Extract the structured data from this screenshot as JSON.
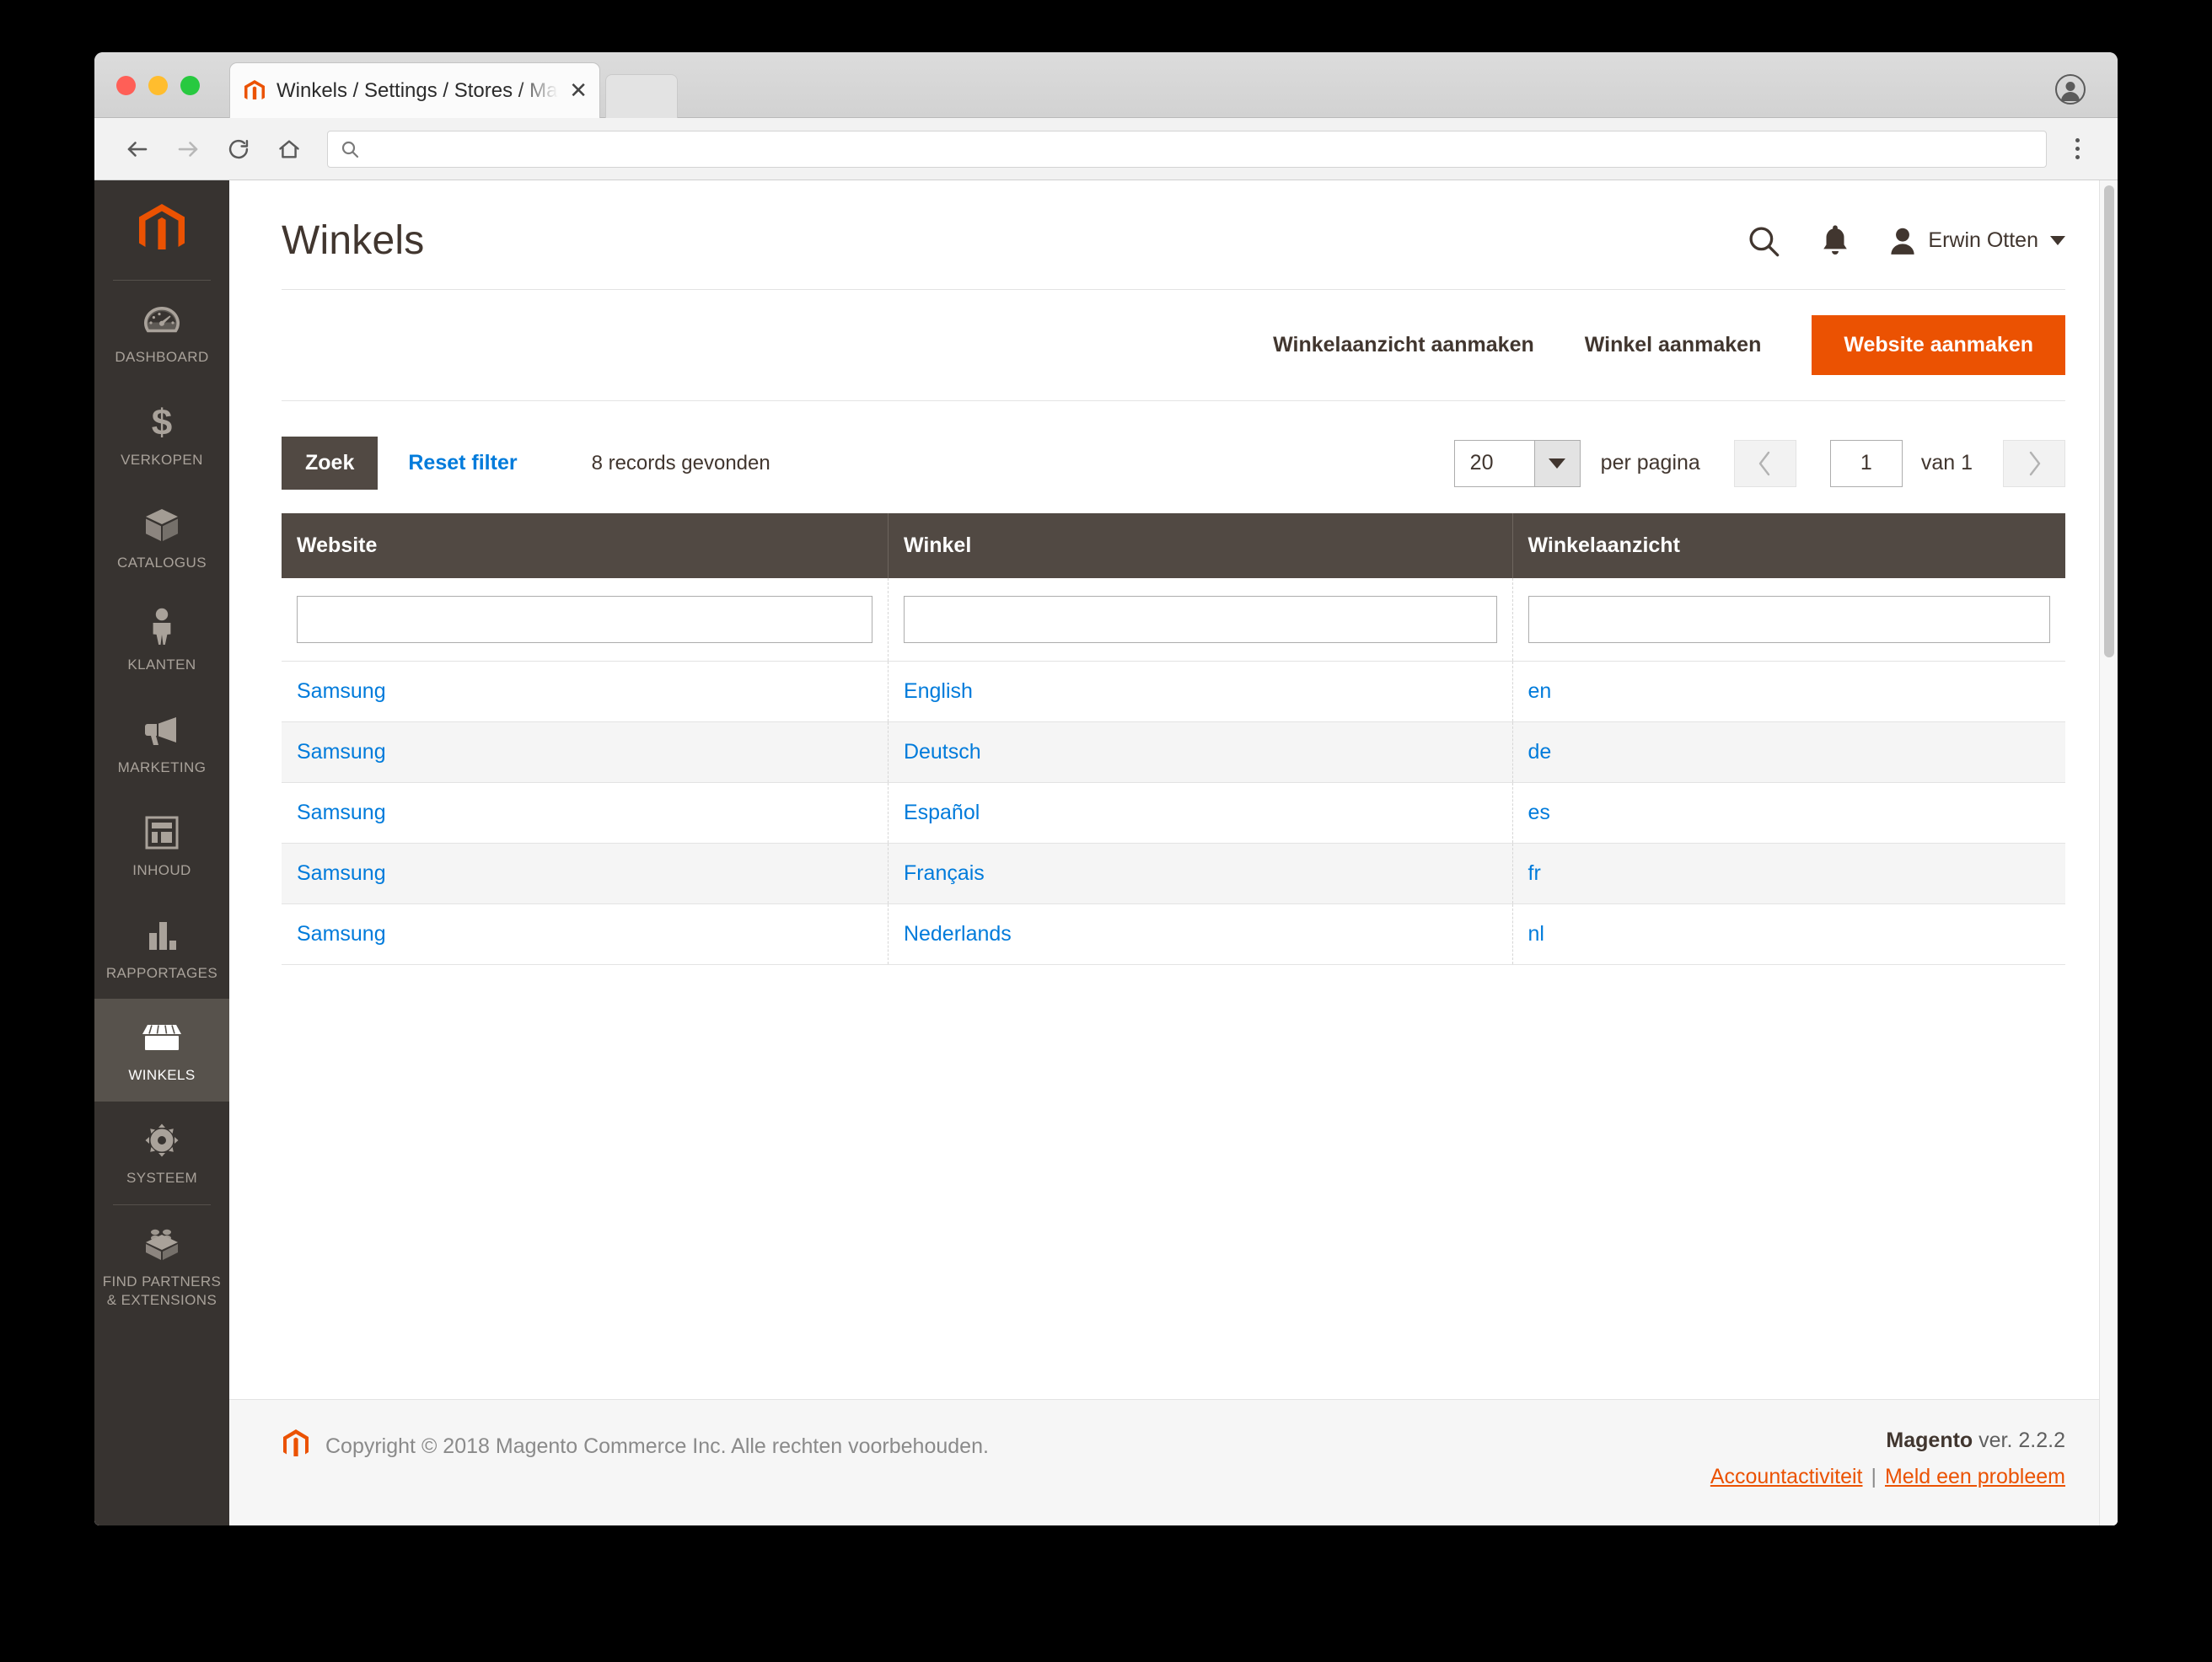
{
  "browser": {
    "tab_title": "Winkels / Settings / Stores / Ma",
    "tab_close": "✕",
    "address_placeholder": "",
    "address_value": ""
  },
  "sidebar": {
    "items": [
      {
        "label": "DASHBOARD",
        "icon": "gauge-icon",
        "active": false
      },
      {
        "label": "VERKOPEN",
        "icon": "dollar-icon",
        "active": false
      },
      {
        "label": "CATALOGUS",
        "icon": "box-icon",
        "active": false
      },
      {
        "label": "KLANTEN",
        "icon": "person-icon",
        "active": false
      },
      {
        "label": "MARKETING",
        "icon": "megaphone-icon",
        "active": false
      },
      {
        "label": "INHOUD",
        "icon": "layout-icon",
        "active": false
      },
      {
        "label": "RAPPORTAGES",
        "icon": "bar-chart-icon",
        "active": false
      },
      {
        "label": "WINKELS",
        "icon": "store-icon",
        "active": true
      },
      {
        "label": "SYSTEEM",
        "icon": "gear-icon",
        "active": false
      },
      {
        "label": "FIND PARTNERS\n& EXTENSIONS",
        "icon": "brick-icon",
        "active": false
      }
    ]
  },
  "header": {
    "title": "Winkels",
    "user_name": "Erwin Otten"
  },
  "actions": {
    "create_store_view": "Winkelaanzicht aanmaken",
    "create_store": "Winkel aanmaken",
    "create_website": "Website aanmaken"
  },
  "grid_toolbar": {
    "search_button": "Zoek",
    "reset_filter": "Reset filter",
    "records_found": "8 records gevonden",
    "per_page_value": "20",
    "per_page_label": "per pagina",
    "page_value": "1",
    "page_total": "van 1",
    "prev_icon": "chevron-left-icon",
    "next_icon": "chevron-right-icon"
  },
  "table": {
    "columns": [
      "Website",
      "Winkel",
      "Winkelaanzicht"
    ],
    "filters": [
      "",
      "",
      ""
    ],
    "rows": [
      {
        "website": "Samsung",
        "store": "English",
        "store_view": "en"
      },
      {
        "website": "Samsung",
        "store": "Deutsch",
        "store_view": "de"
      },
      {
        "website": "Samsung",
        "store": "Español",
        "store_view": "es"
      },
      {
        "website": "Samsung",
        "store": "Français",
        "store_view": "fr"
      },
      {
        "website": "Samsung",
        "store": "Nederlands",
        "store_view": "nl"
      }
    ]
  },
  "footer": {
    "copyright": "Copyright © 2018 Magento Commerce Inc. Alle rechten voorbehouden.",
    "brand": "Magento",
    "version": " ver. 2.2.2",
    "link_account": "Accountactiviteit",
    "link_separator": "|",
    "link_report": "Meld een probleem"
  },
  "colors": {
    "accent": "#eb5202",
    "link": "#007bdb",
    "sidebar_bg": "#373330",
    "sidebar_active": "#57524c",
    "table_header": "#514943"
  }
}
